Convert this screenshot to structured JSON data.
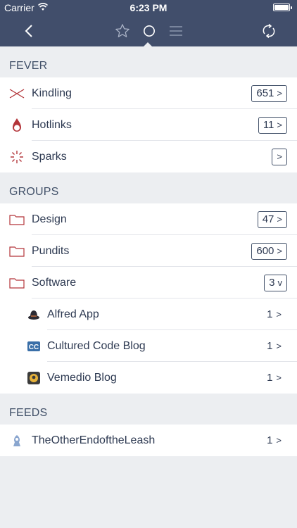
{
  "status_bar": {
    "carrier": "Carrier",
    "time": "6:23 PM"
  },
  "nav": {
    "icons": [
      "back-chevron-icon",
      "star-icon",
      "circle-icon",
      "list-icon",
      "refresh-icon"
    ]
  },
  "fever": {
    "header": "FEVER",
    "items": [
      {
        "label": "Kindling",
        "count": "651",
        "chevron": ">"
      },
      {
        "label": "Hotlinks",
        "count": "11",
        "chevron": ">"
      },
      {
        "label": "Sparks",
        "count": "",
        "chevron": ">"
      }
    ]
  },
  "groups": {
    "header": "GROUPS",
    "items": [
      {
        "label": "Design",
        "count": "47",
        "chevron": ">"
      },
      {
        "label": "Pundits",
        "count": "600",
        "chevron": ">"
      },
      {
        "label": "Software",
        "count": "3",
        "chevron": "v"
      }
    ],
    "software_feeds": [
      {
        "label": "Alfred App",
        "count": "1",
        "chevron": ">"
      },
      {
        "label": "Cultured Code Blog",
        "count": "1",
        "chevron": ">"
      },
      {
        "label": "Vemedio Blog",
        "count": "1",
        "chevron": ">"
      }
    ]
  },
  "feeds": {
    "header": "FEEDS",
    "items": [
      {
        "label": "TheOtherEndoftheLeash",
        "count": "1",
        "chevron": ">"
      }
    ]
  },
  "colors": {
    "nav_bg": "#414e6b",
    "accent_red": "#b3353a",
    "text": "#2e3a52",
    "bg": "#eceef1"
  }
}
